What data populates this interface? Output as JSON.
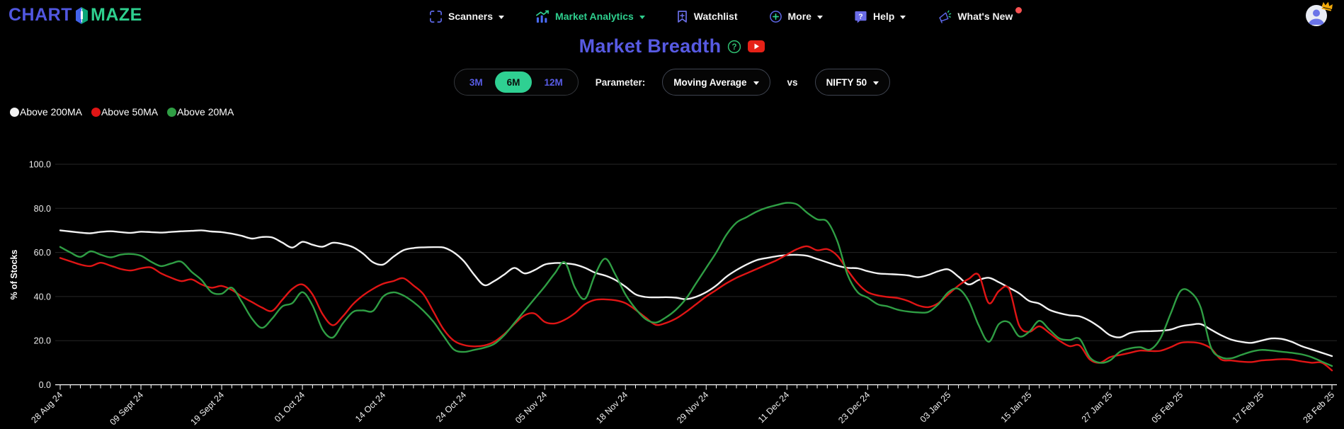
{
  "header": {
    "logo_part1": "CHART",
    "logo_part2": "MAZE",
    "nav": [
      {
        "label": "Scanners",
        "has_caret": true,
        "active": false
      },
      {
        "label": "Market Analytics",
        "has_caret": true,
        "active": true
      },
      {
        "label": "Watchlist",
        "has_caret": false,
        "active": false
      },
      {
        "label": "More",
        "has_caret": true,
        "active": false
      },
      {
        "label": "Help",
        "has_caret": true,
        "active": false
      },
      {
        "label": "What's New",
        "has_caret": false,
        "active": false,
        "notification": true
      }
    ]
  },
  "page": {
    "title": "Market Breadth"
  },
  "controls": {
    "range_options": [
      "3M",
      "6M",
      "12M"
    ],
    "active_range": "6M",
    "parameter_label": "Parameter:",
    "parameter_value": "Moving Average",
    "vs_label": "vs",
    "comparison_value": "NIFTY 50"
  },
  "colors": {
    "accent_purple": "#575ae2",
    "accent_green": "#2fd092",
    "nav_icon_purple": "#5d68e8",
    "notification_red": "#fa5252",
    "crown_gold": "#f2a90a",
    "youtube_red": "#e62117",
    "help_circle_green": "#2fbf71",
    "grid": "#262626",
    "axis": "#ffffff"
  },
  "chart_data": {
    "type": "line",
    "title": "Market Breadth",
    "xlabel": "",
    "ylabel": "% of Stocks",
    "ylim": [
      0,
      100
    ],
    "grid": true,
    "legend_position": "top-left",
    "ytick_labels": [
      "0.0",
      "20.0",
      "40.0",
      "60.0",
      "80.0",
      "100.0"
    ],
    "yticks": [
      0,
      20,
      40,
      60,
      80,
      100
    ],
    "n_points": 127,
    "x_labels": [
      "28 Aug 24",
      "09 Sept 24",
      "19 Sept 24",
      "01 Oct 24",
      "14 Oct 24",
      "24 Oct 24",
      "05 Nov 24",
      "18 Nov 24",
      "29 Nov 24",
      "11 Dec 24",
      "23 Dec 24",
      "03 Jan 25",
      "15 Jan 25",
      "27 Jan 25",
      "05 Feb 25",
      "17 Feb 25",
      "28 Feb 25"
    ],
    "x_label_indices": [
      0,
      8,
      16,
      24,
      32,
      40,
      48,
      56,
      64,
      72,
      80,
      88,
      96,
      104,
      111,
      119,
      126
    ],
    "series": [
      {
        "name": "Above 200MA",
        "color": "#f2f2f2",
        "values": [
          70,
          69.5,
          69,
          68.7,
          69.3,
          69.6,
          69.2,
          68.9,
          69.4,
          69.2,
          69,
          69.3,
          69.6,
          69.8,
          70,
          69.5,
          69.2,
          68.5,
          67.5,
          66.3,
          67,
          66.8,
          64.5,
          62.2,
          64.8,
          63.5,
          62.6,
          64.4,
          63.8,
          62.4,
          59.5,
          55.5,
          54.5,
          58,
          61,
          62,
          62.3,
          62.4,
          62.2,
          60,
          56,
          50,
          45.2,
          47,
          50,
          53,
          50.5,
          52,
          54.5,
          55.2,
          55.1,
          54.5,
          53,
          50.8,
          49.5,
          47.5,
          44.5,
          41,
          39.8,
          39.6,
          39.7,
          39.5,
          38.8,
          39.9,
          42,
          45,
          49,
          52,
          54.5,
          56.5,
          57.5,
          58.3,
          58.8,
          58.9,
          58.5,
          57,
          55.5,
          54,
          53,
          52.8,
          51.5,
          50.5,
          50.2,
          50,
          49.6,
          48.8,
          49.8,
          51.5,
          52.3,
          49,
          45.5,
          47.5,
          48.5,
          46.5,
          44,
          41.5,
          38,
          36.8,
          34,
          32.5,
          31.5,
          31,
          29,
          26,
          22.5,
          21.5,
          23.5,
          24.2,
          24.3,
          24.5,
          25,
          26.5,
          27.2,
          27.5,
          25,
          22.5,
          20.5,
          19.5,
          19,
          20,
          21,
          20.8,
          19.5,
          17.5,
          16,
          14.5,
          13
        ]
      },
      {
        "name": "Above 50MA",
        "color": "#e01515",
        "values": [
          57.5,
          56,
          54.5,
          53.8,
          55.3,
          54,
          52.5,
          51.8,
          52.8,
          53.2,
          50.5,
          48.5,
          47,
          47.8,
          45.5,
          44,
          44.8,
          43,
          40,
          37.5,
          35,
          33.5,
          38.5,
          43.5,
          45.5,
          41,
          32,
          27,
          31,
          36.5,
          40.5,
          43.5,
          45.8,
          47,
          48.3,
          45,
          41,
          33,
          25,
          20,
          18,
          17.4,
          17.8,
          19.5,
          23,
          27.5,
          31.5,
          32.3,
          28.5,
          27.8,
          29.5,
          32.5,
          36.5,
          38.5,
          38.7,
          38.3,
          37,
          34,
          30.5,
          27.2,
          28,
          30,
          33,
          36.5,
          40,
          43,
          46,
          48.5,
          50.5,
          52.5,
          54.5,
          56.5,
          59,
          61.5,
          62.8,
          61,
          61.5,
          58.5,
          52,
          46,
          42,
          40.5,
          39.8,
          39.3,
          38,
          36,
          35.2,
          37,
          41,
          45,
          48,
          49.8,
          37,
          42.5,
          43.5,
          27,
          24,
          26.5,
          23.5,
          20,
          17.5,
          17.8,
          11.5,
          10,
          12.5,
          13.5,
          14.5,
          15.5,
          15.3,
          15.4,
          17,
          19,
          19.3,
          18.7,
          16.5,
          11.5,
          11,
          10.5,
          10.3,
          11,
          11.3,
          11.6,
          11.4,
          10.6,
          10,
          10,
          6.5
        ]
      },
      {
        "name": "Above 20MA",
        "color": "#2f9e44",
        "values": [
          62.5,
          60,
          58,
          60.5,
          59,
          57.8,
          59,
          59.3,
          58.5,
          55.8,
          53.8,
          55,
          55.8,
          51.3,
          47.5,
          42,
          41.3,
          44,
          37.5,
          30,
          25.8,
          30,
          35.5,
          37,
          42,
          36,
          25,
          21.4,
          27.8,
          33,
          33.7,
          33.5,
          40,
          41.9,
          40.5,
          37.5,
          33.5,
          28.5,
          22,
          16,
          14.9,
          15.8,
          16.8,
          18.5,
          22.5,
          28,
          33.5,
          39,
          44.5,
          50.5,
          55.5,
          44,
          39,
          50,
          57.2,
          50,
          41,
          34.5,
          29.8,
          28.2,
          30.5,
          34,
          39,
          46,
          53,
          60,
          68,
          73.5,
          76,
          78.5,
          80.3,
          81.5,
          82.5,
          81.8,
          78,
          75,
          74,
          65,
          50,
          42,
          39.5,
          36.5,
          35.5,
          34,
          33.2,
          32.8,
          33,
          36.5,
          42,
          43.5,
          38,
          27,
          19.5,
          27.5,
          28.3,
          22,
          24,
          29,
          25,
          21,
          20.3,
          20.8,
          12.5,
          10,
          11,
          15,
          16.5,
          17,
          16,
          21,
          32,
          42.5,
          42,
          35,
          17,
          12.5,
          12,
          13.5,
          15,
          15.8,
          15.5,
          15,
          14.5,
          13.8,
          12.5,
          10.5,
          8.5
        ]
      }
    ]
  }
}
